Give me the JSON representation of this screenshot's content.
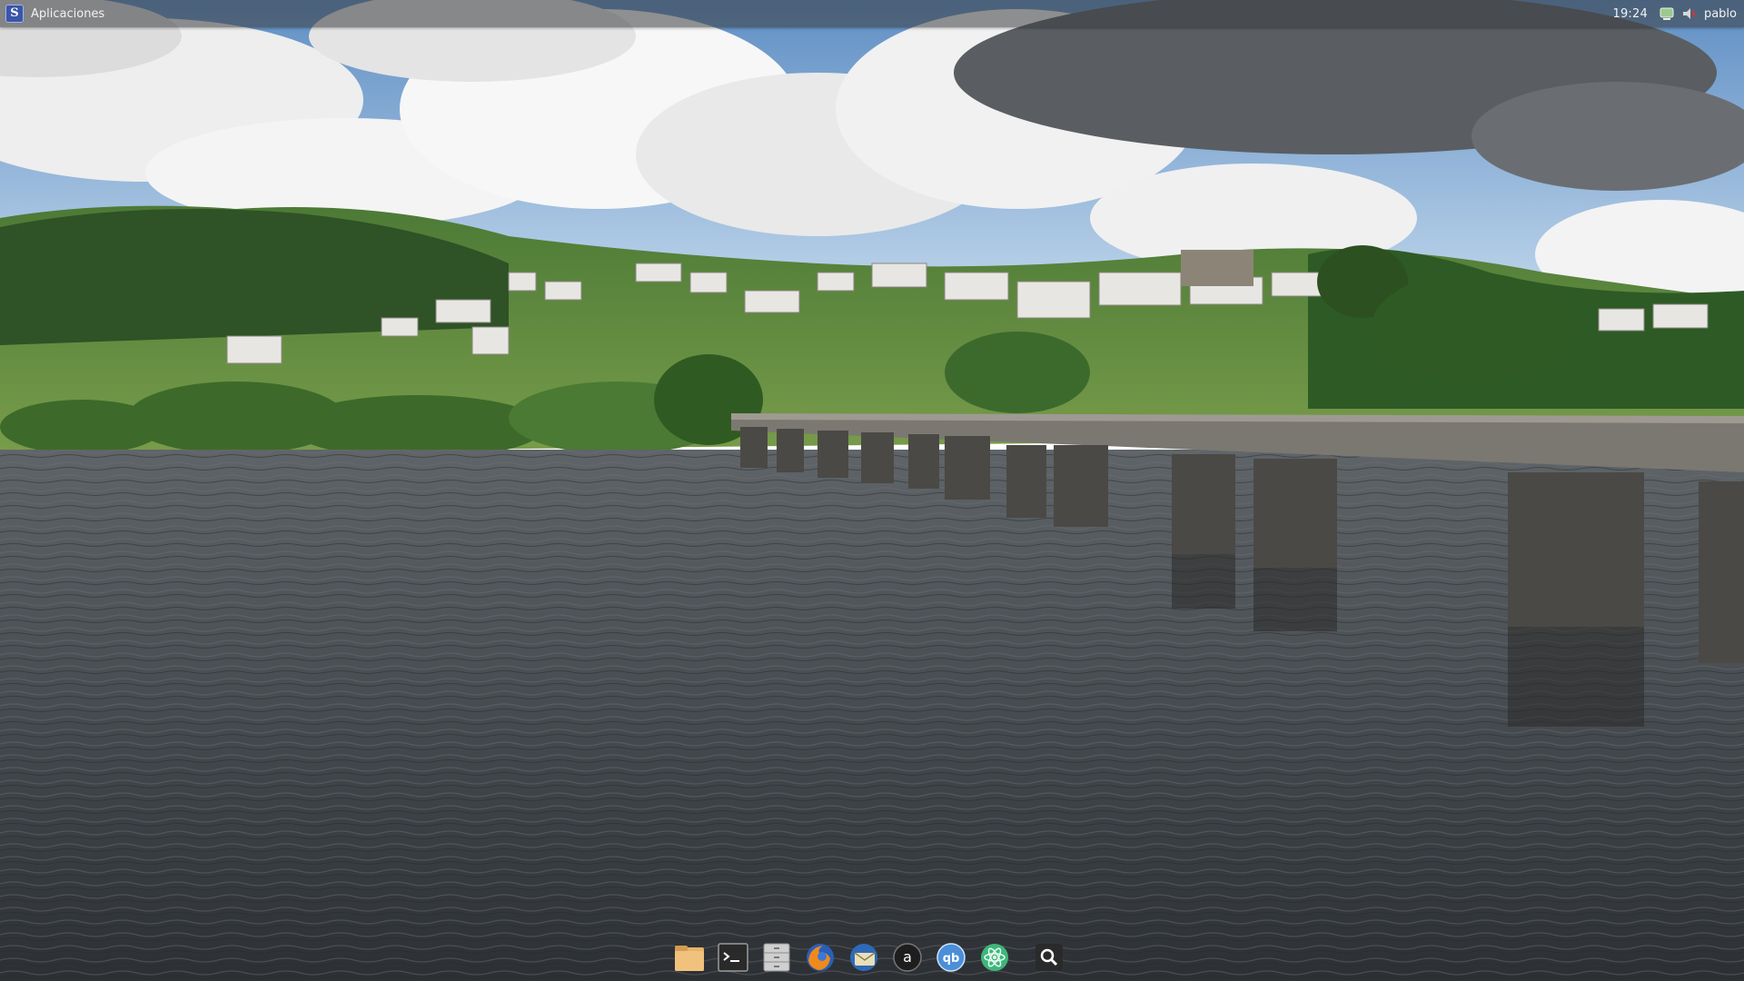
{
  "top_panel": {
    "apps_menu_label": "Aplicaciones",
    "apps_logo_glyph": "S",
    "clock": "19:24",
    "user_name": "pablo",
    "tray_icons": [
      "network-icon",
      "volume-icon"
    ]
  },
  "dock": {
    "items": [
      "file-manager-icon",
      "terminal-icon",
      "file-cabinet-icon",
      "firefox-icon",
      "thunderbird-icon",
      "amarok-icon",
      "qbittorrent-icon",
      "atom-icon",
      "search-icon"
    ]
  },
  "colors": {
    "sky": "#6f9fd0",
    "cloud": "#f2f2f2",
    "hill": "#3f6a2f",
    "water": "#454a4e",
    "bridge": "#6f6c66",
    "panel": "#3a3c40"
  }
}
